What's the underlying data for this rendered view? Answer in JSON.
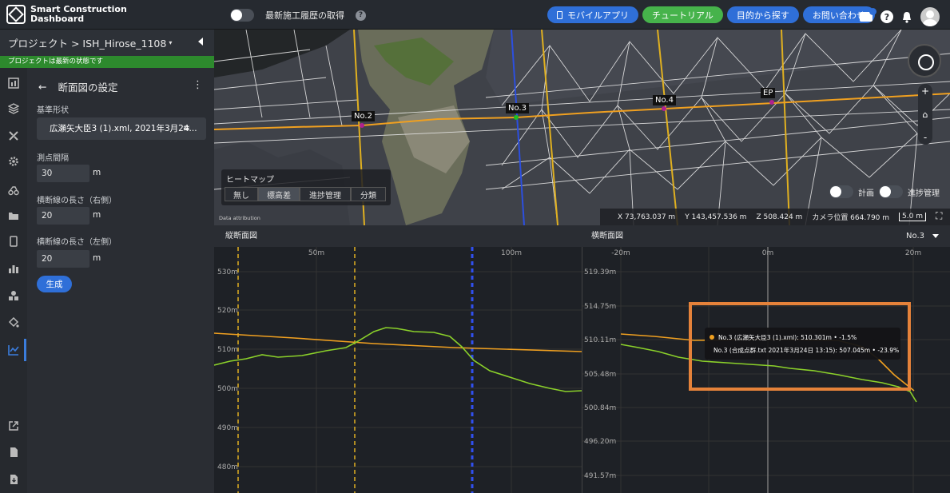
{
  "header": {
    "logo_line1": "Smart Construction",
    "logo_line2": "Dashboard",
    "history_label": "最新施工履歴の取得",
    "buttons": [
      "モバイルアプリ",
      "チュートリアル",
      "目的から探す",
      "お問い合わせ"
    ],
    "colors": {
      "blue": "#2f6fd8",
      "green": "#46b34b"
    }
  },
  "project": {
    "title": "プロジェクト > ISH_Hirose_1108",
    "status": "プロジェクトは最新の状態です"
  },
  "panel": {
    "title": "断面図の設定",
    "base_shape_label": "基準形状",
    "base_shape_value": "広瀬矢大臣3 (1).xml, 2021年3月24...",
    "interval_label": "測点間隔",
    "interval_value": "30",
    "right_len_label": "横断線の長さ（右側）",
    "right_len_value": "20",
    "left_len_label": "横断線の長さ（左側）",
    "left_len_value": "20",
    "unit": "m",
    "generate": "生成"
  },
  "map": {
    "markers": [
      "No.2",
      "No.3",
      "No.4",
      "EP"
    ],
    "heatmap_title": "ヒートマップ",
    "heatmap_options": [
      "無し",
      "標高差",
      "進捗管理",
      "分類"
    ],
    "heatmap_selected": "標高差",
    "toggle_plan": "計画",
    "toggle_progress": "進捗管理",
    "coord_x": "X 73,763.037 m",
    "coord_y": "Y 143,457.536 m",
    "coord_z": "Z 508.424 m",
    "camera": "カメラ位置 664.790 m",
    "scale": "5.0 m",
    "attribution": "Data attribution"
  },
  "longitudinal": {
    "title": "縦断面図",
    "x_ticks": [
      "50m",
      "100m"
    ],
    "y_ticks": [
      "530m",
      "520m",
      "510m",
      "500m",
      "490m",
      "480m"
    ]
  },
  "cross": {
    "title": "横断面図",
    "station": "No.3",
    "x_ticks": [
      "-20m",
      "0m",
      "20m"
    ],
    "y_ticks": [
      "519.39m",
      "514.75m",
      "510.11m",
      "505.48m",
      "500.84m",
      "496.20m",
      "491.57m"
    ],
    "tooltip_1": "No.3 (広瀬矢大臣3 (1).xml): 510.301m • -1.5%",
    "tooltip_2": "No.3 (合成点群.txt 2021年3月24日 13:15): 507.045m • -23.9%",
    "series_colors": {
      "design": "#f0a020",
      "surface": "#8bd12a"
    }
  }
}
